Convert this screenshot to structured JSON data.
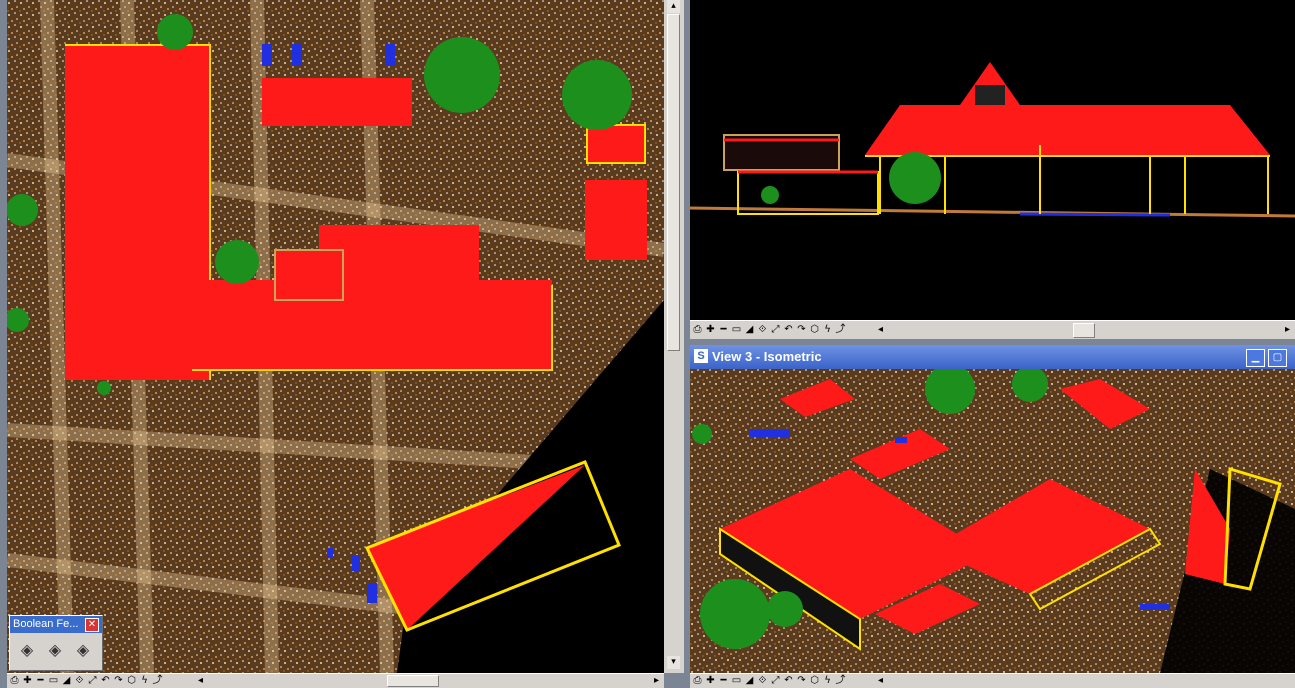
{
  "views": {
    "top": {
      "name": "top-view"
    },
    "elevation": {
      "name": "elevation-view"
    },
    "isometric": {
      "title": "View 3 - Isometric"
    }
  },
  "toolbox": {
    "title": "Boolean Fe...",
    "close_glyph": "✕",
    "buttons": [
      "◈",
      "◈",
      "◈"
    ]
  },
  "view_tools": [
    "⎙",
    "✚",
    "━",
    "▭",
    "◢",
    "⟐",
    "⤢",
    "↶",
    "↷",
    "⬡",
    "ϟ",
    "⤴",
    "◂"
  ],
  "scroll_glyphs": {
    "left": "◂",
    "right": "▸",
    "down": "▾",
    "up": "▴"
  },
  "window_buttons": [
    "▁",
    "▢"
  ],
  "colors": {
    "roof": "#ff1a1a",
    "outline": "#ffe000",
    "tree": "#1d8f1d",
    "points_light": "#d9b07a",
    "points_dark": "#8a5a2b",
    "vehicle": "#2030e0",
    "background": "#000000",
    "titlebar": "#3a63c9"
  }
}
